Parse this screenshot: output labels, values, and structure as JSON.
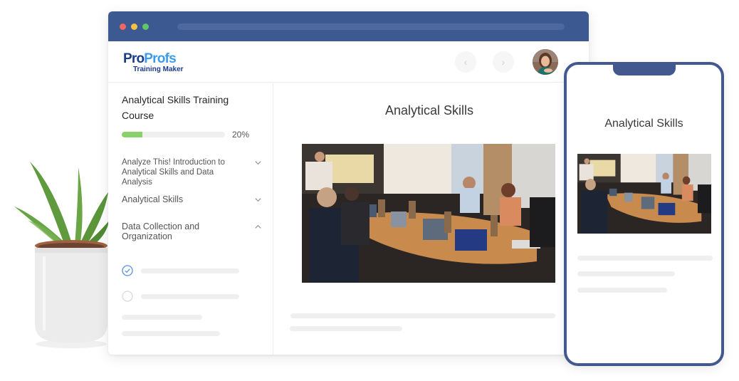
{
  "browser": {
    "window_controls": [
      "close",
      "minimize",
      "maximize"
    ],
    "logo": {
      "brand_part1": "Pro",
      "brand_part2": "Profs",
      "subtitle": "Training Maker",
      "colors": {
        "primary": "#1b3b8c",
        "accent": "#3d9be9"
      }
    },
    "nav": {
      "prev_icon": "chevron-left-icon",
      "next_icon": "chevron-right-icon",
      "prev_glyph": "‹",
      "next_glyph": "›"
    },
    "user_avatar": "user-avatar"
  },
  "sidebar": {
    "course_title": "Analytical Skills Training Course",
    "progress": {
      "percent": 20,
      "label": "20%",
      "color": "#8ad16a"
    },
    "modules": [
      {
        "label": "Analyze This! Introduction to Analytical Skills and Data Analysis",
        "expanded": false
      },
      {
        "label": "Analytical Skills",
        "expanded": false
      },
      {
        "label": "Data Collection and Organization",
        "expanded": true
      }
    ],
    "lessons": [
      {
        "status": "completed"
      },
      {
        "status": "not-started"
      }
    ]
  },
  "main": {
    "title": "Analytical Skills",
    "image_alt": "Team meeting around a conference table with laptops while a presenter speaks"
  },
  "phone": {
    "title": "Analytical Skills",
    "image_alt": "Team meeting around a conference table with laptops while a presenter speaks"
  },
  "theme": {
    "titlebar": "#3c5991",
    "phone_frame": "#43588f",
    "check_color": "#5b8fe0"
  }
}
